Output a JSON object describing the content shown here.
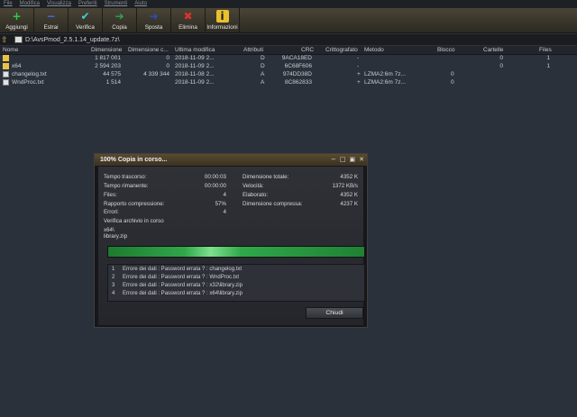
{
  "menu": [
    "File",
    "Modifica",
    "Visualizza",
    "Preferiti",
    "Strumenti",
    "Aiuto"
  ],
  "toolbar": [
    {
      "label": "Aggiungi",
      "icon": "plus-icon",
      "color": "#2ecc40",
      "glyph": "+"
    },
    {
      "label": "Estrai",
      "icon": "minus-icon",
      "color": "#3a6ee8",
      "glyph": "−"
    },
    {
      "label": "Verifica",
      "icon": "check-icon",
      "color": "#3fd0d8",
      "glyph": "✔"
    },
    {
      "label": "Copia",
      "icon": "copy-arrow-icon",
      "color": "#2ea850",
      "glyph": "➔"
    },
    {
      "label": "Sposta",
      "icon": "move-arrow-icon",
      "color": "#2a4fc8",
      "glyph": "➔"
    },
    {
      "label": "Elimina",
      "icon": "delete-x-icon",
      "color": "#e03030",
      "glyph": "✖"
    },
    {
      "label": "Informazioni",
      "icon": "info-icon",
      "color": "#e8c030",
      "glyph": "i"
    }
  ],
  "address": {
    "path": "D:\\AvsPmod_2.5.1.14_update.7z\\"
  },
  "columns": [
    "Nome",
    "Dimensione",
    "Dimensione c...",
    "Ultima modifica",
    "Attributi",
    "CRC",
    "Crittografato",
    "Metodo",
    "Blocco",
    "Cartelle",
    "Files"
  ],
  "rows": [
    {
      "type": "folder",
      "name": "",
      "size": "1 817 001",
      "packed": "0",
      "modified": "2018-11-09 2...",
      "attr": "D",
      "crc": "9ACA18ED",
      "enc": "-",
      "method": "",
      "block": "",
      "folders": "0",
      "files": "1"
    },
    {
      "type": "folder",
      "name": "x64",
      "size": "2 594 203",
      "packed": "0",
      "modified": "2018-11-09 2...",
      "attr": "D",
      "crc": "6C68F606",
      "enc": "-",
      "method": "",
      "block": "",
      "folders": "0",
      "files": "1"
    },
    {
      "type": "file",
      "name": "changelog.txt",
      "size": "44 575",
      "packed": "4 339 344",
      "modified": "2018-11-08 2...",
      "attr": "A",
      "crc": "974DD38D",
      "enc": "+",
      "method": "LZMA2:6m 7z...",
      "block": "0",
      "folders": "",
      "files": ""
    },
    {
      "type": "file",
      "name": "WndProc.txt",
      "size": "1 514",
      "packed": "",
      "modified": "2018-11-09 2...",
      "attr": "A",
      "crc": "8C862833",
      "enc": "+",
      "method": "LZMA2:6m 7z...",
      "block": "0",
      "folders": "",
      "files": ""
    }
  ],
  "dialog": {
    "title": "100% Copia in corso...",
    "left": [
      {
        "label": "Tempo trascorso:",
        "value": "00:00:03"
      },
      {
        "label": "Tempo rimanente:",
        "value": "00:00:00"
      },
      {
        "label": "Files:",
        "value": "4"
      },
      {
        "label": "Rapporto compressione:",
        "value": "57%"
      },
      {
        "label": "Errori:",
        "value": "4"
      }
    ],
    "right": [
      {
        "label": "Dimensione totale:",
        "value": "4352 K"
      },
      {
        "label": "Velocità:",
        "value": "1372 KB/s"
      },
      {
        "label": "Elaborato:",
        "value": "4352 K"
      },
      {
        "label": "Dimensione compressa:",
        "value": "4237 K"
      }
    ],
    "status": "Verifica archivio in corso",
    "current_dir": "x64\\",
    "current_file": "library.zip",
    "progress_percent": 100,
    "errors": [
      {
        "n": "1",
        "text": "Errore dei dati : Password errata ? : changelog.txt"
      },
      {
        "n": "2",
        "text": "Errore dei dati : Password errata ? : WndProc.txt"
      },
      {
        "n": "3",
        "text": "Errore dei dati : Password errata ? : x32\\library.zip"
      },
      {
        "n": "4",
        "text": "Errore dei dati : Password errata ? : x64\\library.zip"
      }
    ],
    "close_label": "Chiudi"
  }
}
